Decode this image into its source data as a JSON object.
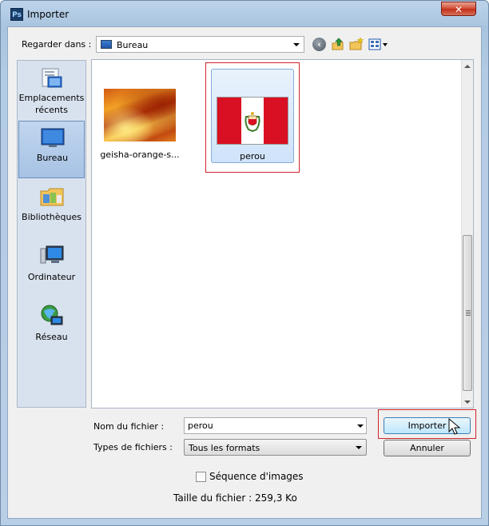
{
  "window": {
    "title": "Importer",
    "app_icon": "Ps",
    "close_glyph": "✕"
  },
  "toolbar": {
    "lookin_label": "Regarder dans :",
    "lookin_value": "Bureau",
    "back_glyph": "‹"
  },
  "places": [
    {
      "label": "Emplacements récents",
      "icon": "recent-places-icon"
    },
    {
      "label": "Bureau",
      "icon": "desktop-icon",
      "selected": true
    },
    {
      "label": "Bibliothèques",
      "icon": "libraries-icon"
    },
    {
      "label": "Ordinateur",
      "icon": "computer-icon"
    },
    {
      "label": "Réseau",
      "icon": "network-icon"
    }
  ],
  "files": [
    {
      "name": "geisha-orange-s...",
      "icon": "image-thumbnail"
    },
    {
      "name": "perou",
      "icon": "peru-flag-thumbnail",
      "selected": true
    }
  ],
  "form": {
    "filename_label": "Nom du fichier :",
    "filename_value": "perou",
    "filetype_label": "Types de fichiers :",
    "filetype_value": "Tous les formats",
    "import_button": "Importer",
    "cancel_button": "Annuler",
    "sequence_label": "Séquence d'images",
    "sequence_checked": false,
    "filesize_text": "Taille du fichier : 259,3 Ko"
  },
  "colors": {
    "highlight_red": "#d2232a",
    "selection_blue": "#cfe3fa",
    "accent_blue": "#3c7fb1"
  }
}
